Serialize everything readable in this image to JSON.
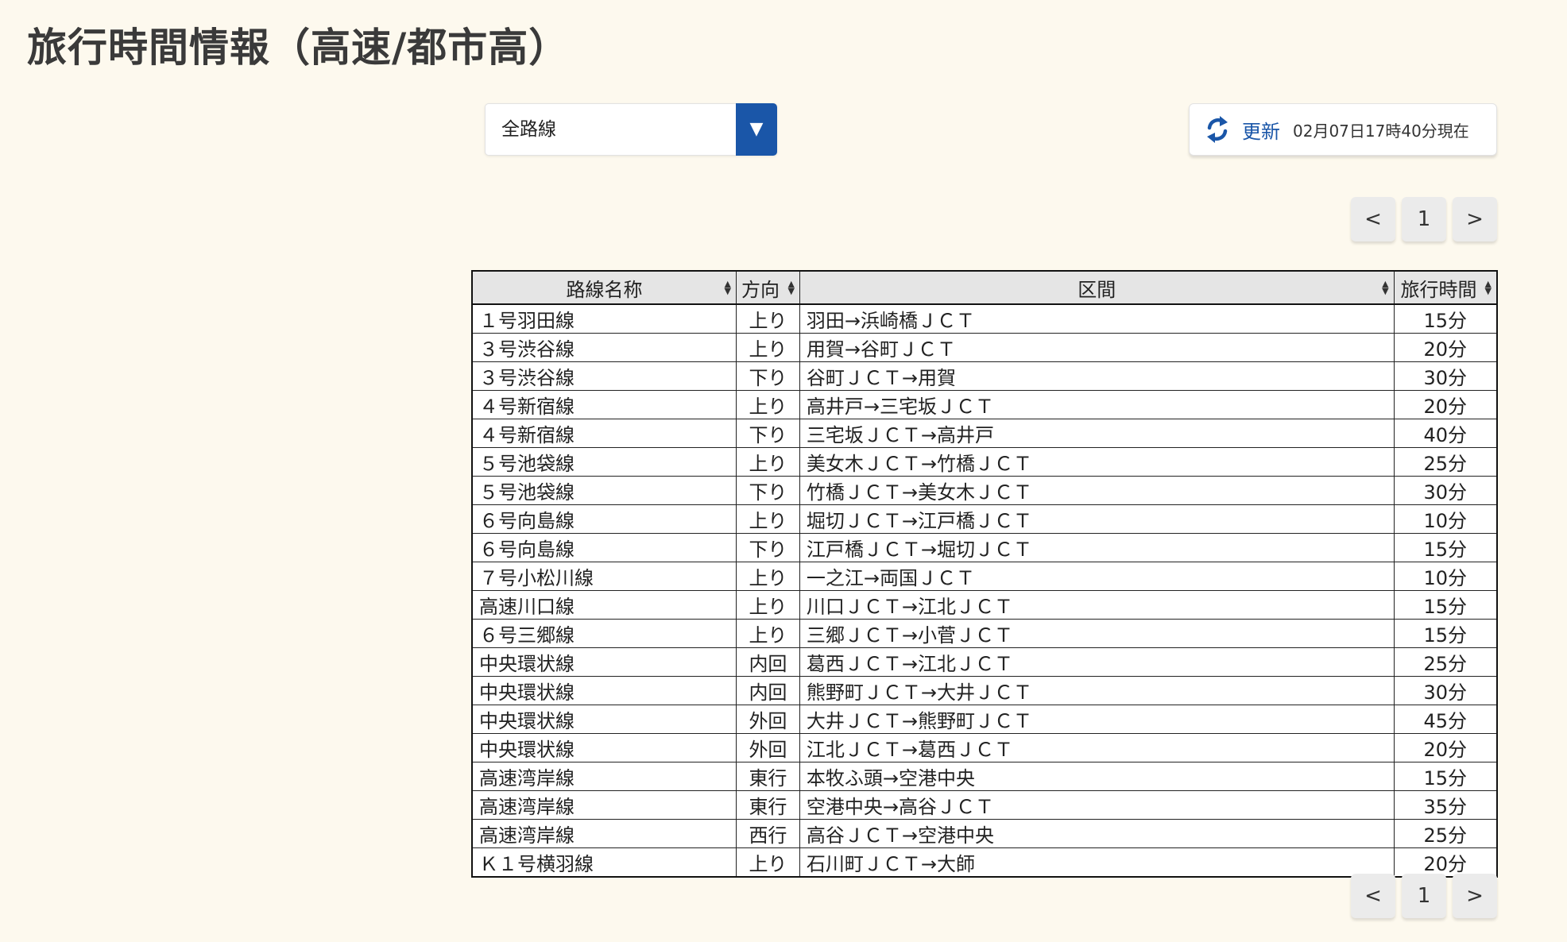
{
  "page": {
    "title": "旅行時間情報（高速/都市高）"
  },
  "route_select": {
    "value": "全路線"
  },
  "refresh": {
    "label": "更新",
    "updated_at": "02月07日17時40分現在"
  },
  "pager": {
    "prev": "<",
    "page": "1",
    "next": ">"
  },
  "table": {
    "headers": {
      "route": "路線名称",
      "direction": "方向",
      "section": "区間",
      "time": "旅行時間"
    },
    "rows": [
      {
        "route": "１号羽田線",
        "direction": "上り",
        "section": "羽田→浜崎橋ＪＣＴ",
        "time": "15分"
      },
      {
        "route": "３号渋谷線",
        "direction": "上り",
        "section": "用賀→谷町ＪＣＴ",
        "time": "20分"
      },
      {
        "route": "３号渋谷線",
        "direction": "下り",
        "section": "谷町ＪＣＴ→用賀",
        "time": "30分"
      },
      {
        "route": "４号新宿線",
        "direction": "上り",
        "section": "高井戸→三宅坂ＪＣＴ",
        "time": "20分"
      },
      {
        "route": "４号新宿線",
        "direction": "下り",
        "section": "三宅坂ＪＣＴ→高井戸",
        "time": "40分"
      },
      {
        "route": "５号池袋線",
        "direction": "上り",
        "section": "美女木ＪＣＴ→竹橋ＪＣＴ",
        "time": "25分"
      },
      {
        "route": "５号池袋線",
        "direction": "下り",
        "section": "竹橋ＪＣＴ→美女木ＪＣＴ",
        "time": "30分"
      },
      {
        "route": "６号向島線",
        "direction": "上り",
        "section": "堀切ＪＣＴ→江戸橋ＪＣＴ",
        "time": "10分"
      },
      {
        "route": "６号向島線",
        "direction": "下り",
        "section": "江戸橋ＪＣＴ→堀切ＪＣＴ",
        "time": "15分"
      },
      {
        "route": "７号小松川線",
        "direction": "上り",
        "section": "一之江→両国ＪＣＴ",
        "time": "10分"
      },
      {
        "route": "高速川口線",
        "direction": "上り",
        "section": "川口ＪＣＴ→江北ＪＣＴ",
        "time": "15分"
      },
      {
        "route": "６号三郷線",
        "direction": "上り",
        "section": "三郷ＪＣＴ→小菅ＪＣＴ",
        "time": "15分"
      },
      {
        "route": "中央環状線",
        "direction": "内回",
        "section": "葛西ＪＣＴ→江北ＪＣＴ",
        "time": "25分"
      },
      {
        "route": "中央環状線",
        "direction": "内回",
        "section": "熊野町ＪＣＴ→大井ＪＣＴ",
        "time": "30分"
      },
      {
        "route": "中央環状線",
        "direction": "外回",
        "section": "大井ＪＣＴ→熊野町ＪＣＴ",
        "time": "45分"
      },
      {
        "route": "中央環状線",
        "direction": "外回",
        "section": "江北ＪＣＴ→葛西ＪＣＴ",
        "time": "20分"
      },
      {
        "route": "高速湾岸線",
        "direction": "東行",
        "section": "本牧ふ頭→空港中央",
        "time": "15分"
      },
      {
        "route": "高速湾岸線",
        "direction": "東行",
        "section": "空港中央→高谷ＪＣＴ",
        "time": "35分"
      },
      {
        "route": "高速湾岸線",
        "direction": "西行",
        "section": "高谷ＪＣＴ→空港中央",
        "time": "25分"
      },
      {
        "route": "Ｋ１号横羽線",
        "direction": "上り",
        "section": "石川町ＪＣＴ→大師",
        "time": "20分"
      }
    ]
  },
  "colors": {
    "accent": "#1a56a8",
    "background": "#fdf9ee",
    "header_bg": "#e5e5e5"
  },
  "icons": {
    "refresh": "refresh-icon",
    "dropdown": "chevron-down-icon",
    "sort": "sort-icon"
  }
}
